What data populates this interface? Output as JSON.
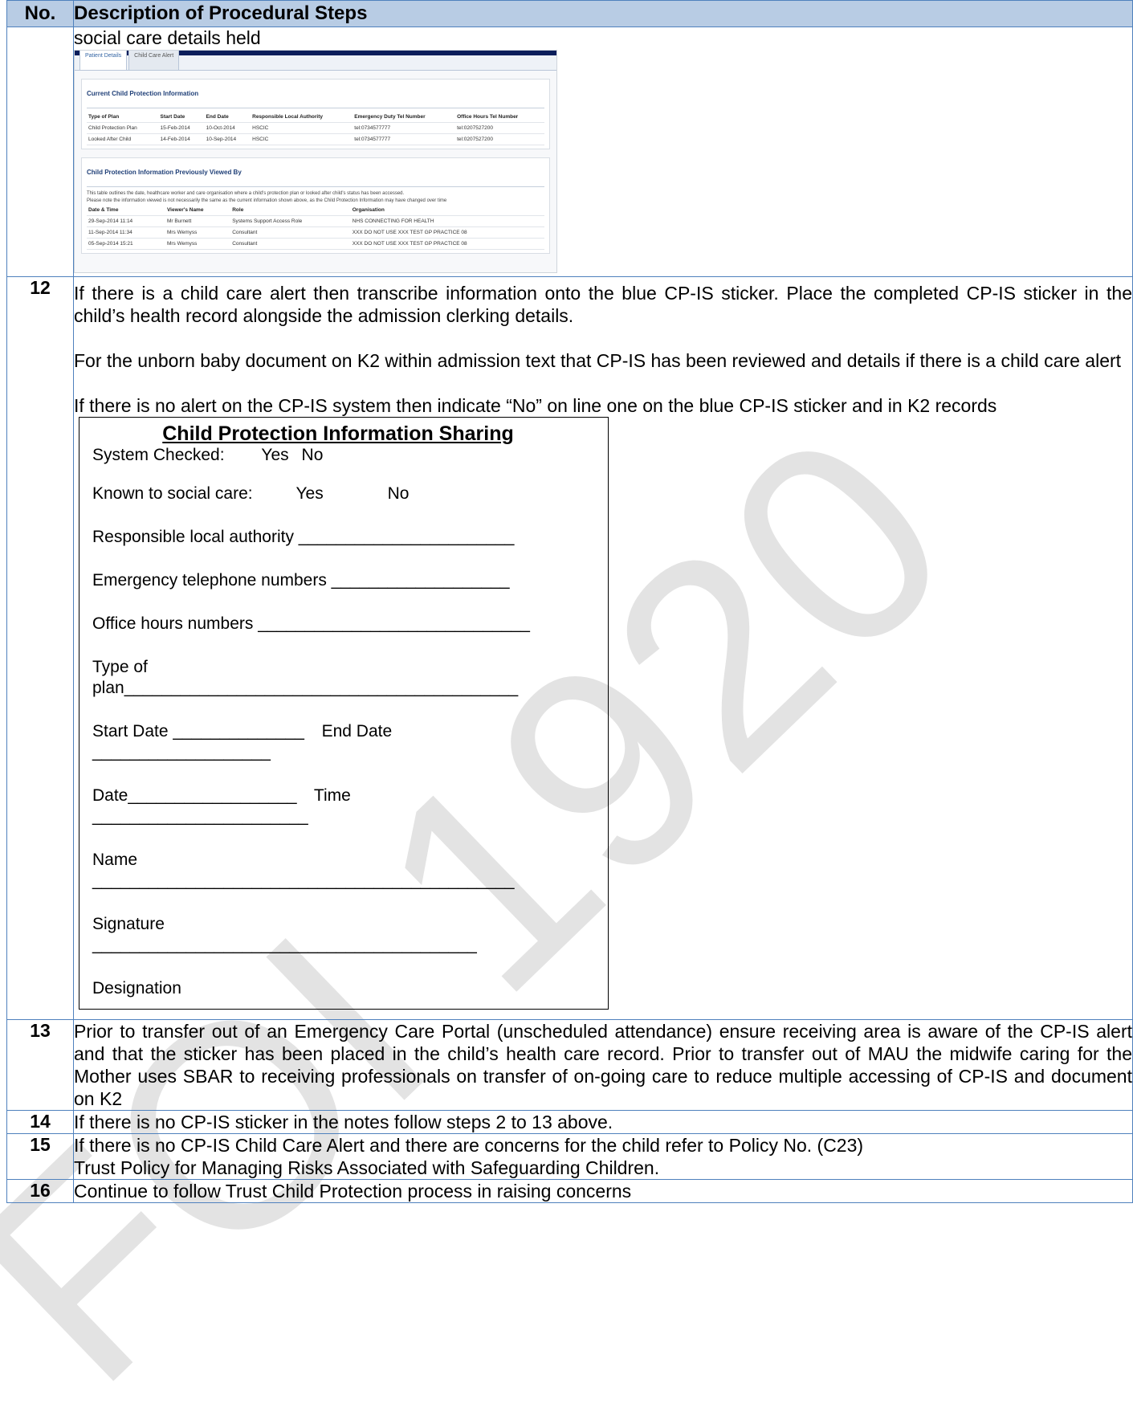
{
  "watermark": "FOI 1920",
  "header": {
    "no": "No.",
    "desc": "Description of Procedural Steps"
  },
  "rows": {
    "r12": {
      "num": "12",
      "intro": "social care details held",
      "screenshot": {
        "tabs": [
          "Patient Details",
          "Child Care Alert"
        ],
        "current": {
          "title": "Current Child Protection Information",
          "headers": [
            "Type of Plan",
            "Start Date",
            "End Date",
            "Responsible Local Authority",
            "Emergency Duty Tel Number",
            "Office Hours Tel Number"
          ],
          "rows": [
            [
              "Child Protection Plan",
              "15-Feb-2014",
              "10-Oct-2014",
              "HSCIC",
              "tel:0734577777",
              "tel:0207527200"
            ],
            [
              "Looked After Child",
              "14-Feb-2014",
              "10-Sep-2014",
              "HSCIC",
              "tel:0734577777",
              "tel:0207527200"
            ]
          ]
        },
        "previous": {
          "title": "Child Protection Information Previously Viewed By",
          "note1": "This table outlines the date, healthcare worker and care organisation where a child's protection plan or looked after child's status has been accessed.",
          "note2": "Please note the information viewed is not necessarily the same as the current information shown above, as the Child Protection Information may have changed over time",
          "headers": [
            "Date & Time",
            "Viewer's Name",
            "Role",
            "Organisation"
          ],
          "rows": [
            [
              "29-Sep-2014 11:14",
              "Mr Burnett",
              "Systems Support Access Role",
              "NHS CONNECTING FOR HEALTH"
            ],
            [
              "11-Sep-2014 11:34",
              "Mrs Wemyss",
              "Consultant",
              "XXX DO NOT USE XXX TEST GP PRACTICE 08"
            ],
            [
              "05-Sep-2014 15:21",
              "Mrs Wemyss",
              "Consultant",
              "XXX DO NOT USE XXX TEST GP PRACTICE 08"
            ]
          ]
        }
      }
    },
    "r12b": {
      "num": "12",
      "p1": "If there is a child care alert then transcribe information onto the blue CP-IS sticker. Place the completed CP-IS sticker in the child’s health record alongside the admission clerking details.",
      "p2": "For the unborn baby document on K2 within admission text that CP-IS has been reviewed and details if there is a child care alert",
      "p3": "If there is no alert on the CP-IS system then indicate “No” on line one on the blue CP-IS sticker and in K2 records",
      "sticker": {
        "title": "Child Protection Information Sharing",
        "system_checked": "System Checked:",
        "yes": "Yes",
        "no": "No",
        "known": "Known to social care:",
        "authority": "Responsible local authority _______________________",
        "emergency": "Emergency telephone numbers ___________________",
        "office": "Office hours numbers _____________________________",
        "type1": "Type of",
        "type2": "plan__________________________________________",
        "start": "Start Date ______________",
        "end": "End Date",
        "end_line": "___________________",
        "date": "Date__________________",
        "time": "Time",
        "time_line": "_______________________",
        "name": "Name",
        "name_line": "_____________________________________________",
        "signature": "Signature",
        "signature_line": "_________________________________________",
        "designation": "Designation"
      }
    },
    "r13": {
      "num": "13",
      "text": "Prior to transfer out of an Emergency Care Portal (unscheduled attendance) ensure receiving area is aware of the CP-IS alert and that the sticker has been placed in the child’s health care record. Prior to transfer out of MAU the midwife caring for the Mother uses SBAR to receiving professionals on transfer of on-going care to reduce multiple accessing of CP-IS and document on K2"
    },
    "r14": {
      "num": "14",
      "text": "If there is no CP-IS sticker in the notes follow steps 2 to 13 above."
    },
    "r15": {
      "num": "15",
      "line1": "If there is no CP-IS Child Care Alert and there are concerns for the child refer to Policy No. (C23)",
      "line2": "Trust Policy for Managing Risks Associated with Safeguarding Children."
    },
    "r16": {
      "num": "16",
      "text": "Continue to follow Trust Child Protection process in raising concerns"
    }
  }
}
